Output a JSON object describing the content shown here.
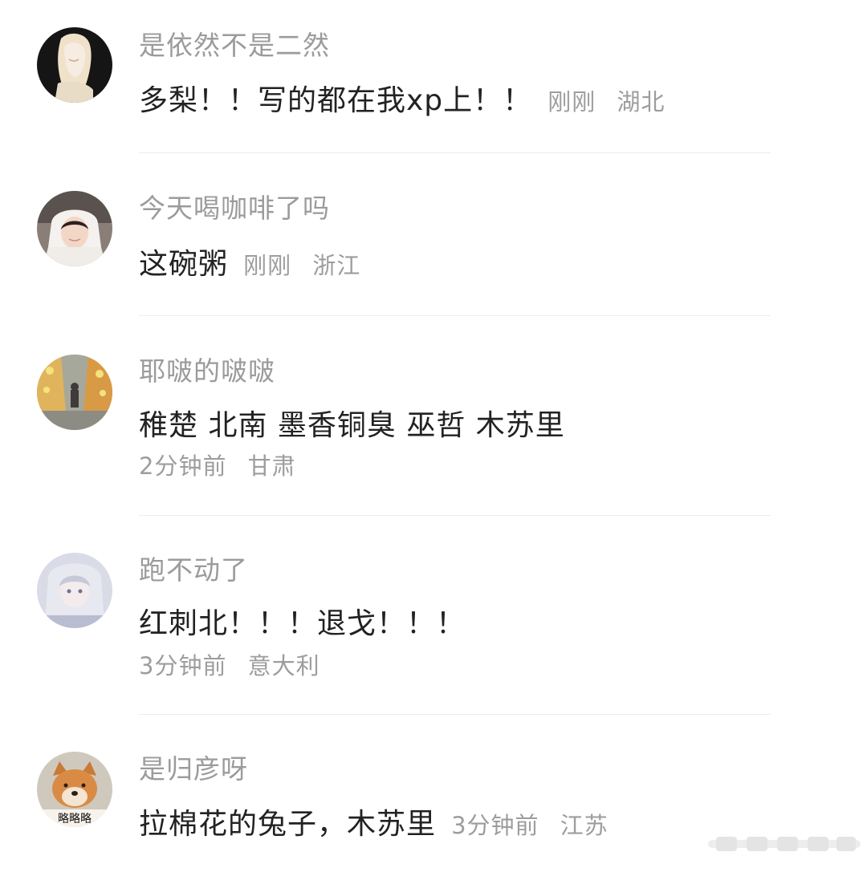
{
  "comments": [
    {
      "username": "是依然不是二然",
      "content": "多梨！！写的都在我xp上！！",
      "time": "刚刚",
      "location": "湖北",
      "avatar_icon": "avatar-anime-blonde-girl"
    },
    {
      "username": "今天喝咖啡了吗",
      "content": "这碗粥",
      "time": "刚刚",
      "location": "浙江",
      "avatar_icon": "avatar-girl-white-hood"
    },
    {
      "username": "耶啵的啵啵",
      "content": "稚楚 北南 墨香铜臭 巫哲 木苏里",
      "time": "2分钟前",
      "location": "甘肃",
      "avatar_icon": "avatar-street-scene"
    },
    {
      "username": "跑不动了",
      "content": "红刺北！！！退戈！！！",
      "time": "3分钟前",
      "location": "意大利",
      "avatar_icon": "avatar-anime-silver-hair"
    },
    {
      "username": "是归彦呀",
      "content": "拉棉花的兔子，木苏里",
      "time": "3分钟前",
      "location": "江苏",
      "avatar_icon": "avatar-shiba-dog",
      "avatar_caption": "略略略"
    }
  ],
  "colors": {
    "username": "#9b9b9b",
    "content": "#222222",
    "meta": "#9d9d9d",
    "divider": "#ececec",
    "background": "#ffffff"
  }
}
